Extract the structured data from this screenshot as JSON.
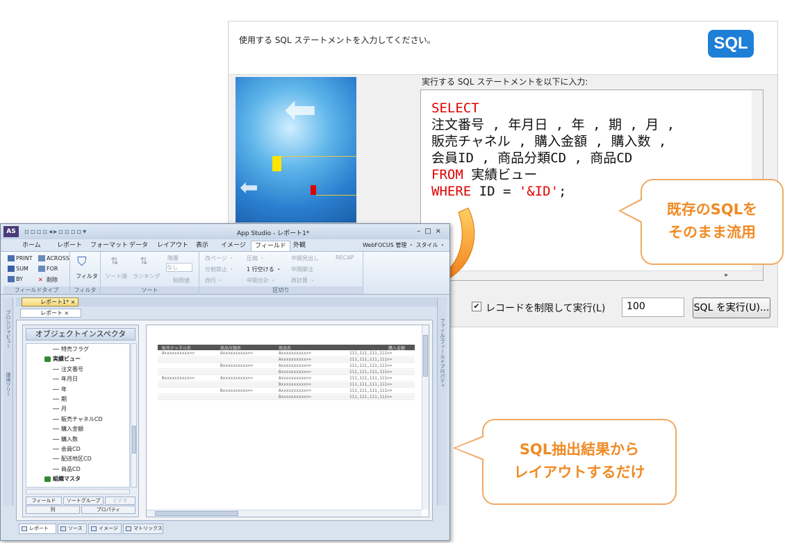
{
  "sql_dialog": {
    "prompt": "使用する SQL ステートメントを入力してください。",
    "logo_text": "SQL",
    "editor_label": "実行する SQL ステートメントを以下に入力:",
    "sql_lines": [
      {
        "kw": "SELECT",
        "rest": ""
      },
      {
        "kw": "",
        "rest": "注文番号 , 年月日 , 年 , 期 , 月 ,"
      },
      {
        "kw": "",
        "rest": "販売チャネル , 購入金額 , 購入数 ,"
      },
      {
        "kw": "",
        "rest": "会員ID , 商品分類CD , 商品CD"
      },
      {
        "kw": "FROM",
        "rest": " 実績ビュー"
      },
      {
        "kw": "WHERE",
        "rest": " ID = ",
        "str": "'&ID'",
        "tail": ";"
      }
    ],
    "limit_checkbox_label": "レコードを制限して実行(L)",
    "limit_checked": true,
    "limit_value": "100",
    "run_button": "SQL を実行(U)..."
  },
  "callouts": {
    "top": [
      "既存のSQLを",
      "そのまま流用"
    ],
    "bottom": [
      "SQL抽出結果から",
      "レイアウトするだけ"
    ]
  },
  "app": {
    "logo": "AS",
    "title": "App Studio - レポート1*",
    "menu_tabs": [
      "ホーム",
      "レポート",
      "フォーマット",
      "データ",
      "レイアウト",
      "表示",
      "イメージ",
      "フィールド",
      "外観"
    ],
    "active_tab": "フィールド",
    "menu_right": "WebFOCUS 管理 ・ スタイル ・",
    "ribbon": {
      "field_type": {
        "items": [
          "PRINT",
          "ACROSS",
          "SUM",
          "FOR",
          "BY",
          "削除"
        ],
        "caption": "フィールドタイプ"
      },
      "filter": {
        "item": "フィルタ",
        "caption": "フィルタ"
      },
      "sort": {
        "items": [
          "ソート順",
          "ランキング",
          "階層",
          "なし",
          "制限値"
        ],
        "caption": "ソート"
      },
      "break": {
        "items": [
          "改ページ ・",
          "圧縮 ・",
          "中間見出し",
          "RECAP",
          "分割禁止 ・",
          "1 行空ける ・",
          "中間脚注",
          "改行 ・",
          "中間合計 ・",
          "再計算 ・"
        ],
        "caption": "区切り"
      }
    },
    "doc_tab": "レポート1*",
    "doc_subtab": "レポート",
    "left_strip": [
      "プロシジャビュー",
      "環境ツリー"
    ],
    "right_strip": "ファイル/フィールドプロパティ",
    "inspector_title": "オブジェクトインスペクタ",
    "tree": [
      {
        "label": "特売フラグ",
        "type": "leaf",
        "indent": 1
      },
      {
        "label": "実績ビュー",
        "type": "group",
        "indent": 0
      },
      {
        "label": "注文番号",
        "type": "leaf",
        "indent": 1
      },
      {
        "label": "年月日",
        "type": "leaf",
        "indent": 1
      },
      {
        "label": "年",
        "type": "leaf",
        "indent": 1
      },
      {
        "label": "期",
        "type": "leaf",
        "indent": 1
      },
      {
        "label": "月",
        "type": "leaf",
        "indent": 1
      },
      {
        "label": "販売チャネルCD",
        "type": "leaf",
        "indent": 1
      },
      {
        "label": "購入金額",
        "type": "leaf",
        "indent": 1
      },
      {
        "label": "購入数",
        "type": "leaf",
        "indent": 1
      },
      {
        "label": "会員CD",
        "type": "leaf",
        "indent": 1
      },
      {
        "label": "配送地区CD",
        "type": "leaf",
        "indent": 1
      },
      {
        "label": "商品CD",
        "type": "leaf",
        "indent": 1
      },
      {
        "label": "組織マスタ",
        "type": "group",
        "indent": 0
      }
    ],
    "inspector_tabs": {
      "row1": [
        "フィールド",
        "ソートグループ",
        "ビデオ"
      ],
      "row2": [
        "列",
        "プロパティ"
      ]
    },
    "report_header": [
      "販売チャネル名",
      "商品分類名",
      "商品名",
      "購入金額"
    ],
    "report_rows": [
      [
        "Axxxxxxxxxx>>",
        "Axxxxxxxxxx>>",
        "Axxxxxxxxxx>>",
        "111,111,111,111>>"
      ],
      [
        "",
        "",
        "Axxxxxxxxxx>>",
        "111,111,111,111>>"
      ],
      [
        "",
        "Bxxxxxxxxxx>>",
        "Axxxxxxxxxx>>",
        "111,111,111,111>>"
      ],
      [
        "",
        "",
        "Bxxxxxxxxxx>>",
        "111,111,111,111>>"
      ],
      [
        "Bxxxxxxxxxx>>",
        "Axxxxxxxxxx>>",
        "Axxxxxxxxxx>>",
        "111,111,111,111>>"
      ],
      [
        "",
        "",
        "Bxxxxxxxxxx>>",
        "111,111,111,111>>"
      ],
      [
        "",
        "Bxxxxxxxxxx>>",
        "Axxxxxxxxxx>>",
        "111,111,111,111>>"
      ],
      [
        "",
        "",
        "Bxxxxxxxxxx>>",
        "111,111,111,111>>"
      ]
    ],
    "bottom_tabs": [
      "レポート",
      "ソース",
      "イメージ",
      "マトリックス"
    ]
  },
  "colors": {
    "accent_orange": "#f08a24",
    "sql_keyword": "#e00000",
    "sql_logo": "#1e7fd6"
  }
}
